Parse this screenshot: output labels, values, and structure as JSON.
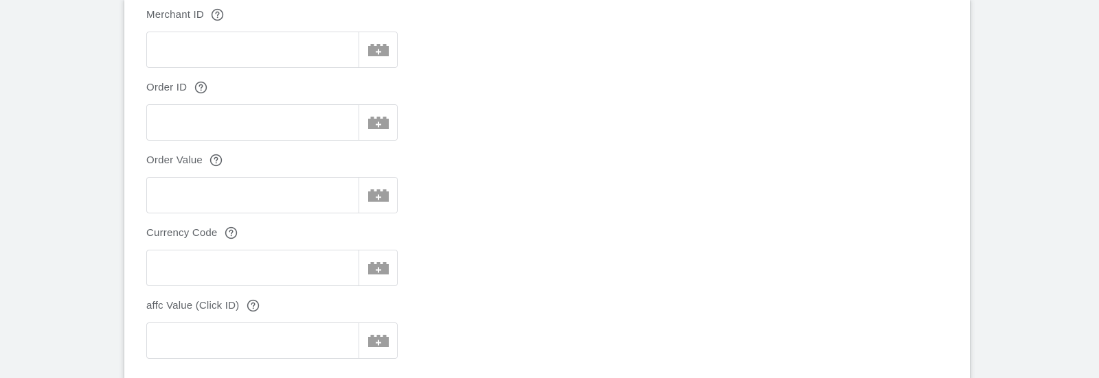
{
  "fields": [
    {
      "label": "Merchant ID",
      "value": "",
      "help_icon": "help-circle-icon",
      "variable_icon": "add-variable-brick-icon"
    },
    {
      "label": "Order ID",
      "value": "",
      "help_icon": "help-circle-icon",
      "variable_icon": "add-variable-brick-icon"
    },
    {
      "label": "Order Value",
      "value": "",
      "help_icon": "help-circle-icon",
      "variable_icon": "add-variable-brick-icon"
    },
    {
      "label": "Currency Code",
      "value": "",
      "help_icon": "help-circle-icon",
      "variable_icon": "add-variable-brick-icon"
    },
    {
      "label": "affc Value (Click ID)",
      "value": "",
      "help_icon": "help-circle-icon",
      "variable_icon": "add-variable-brick-icon"
    }
  ],
  "colors": {
    "page_background": "#f1f3f4",
    "card_background": "#ffffff",
    "label_text": "#5f6368",
    "border": "#dadce0",
    "icon": "#9e9e9e"
  }
}
